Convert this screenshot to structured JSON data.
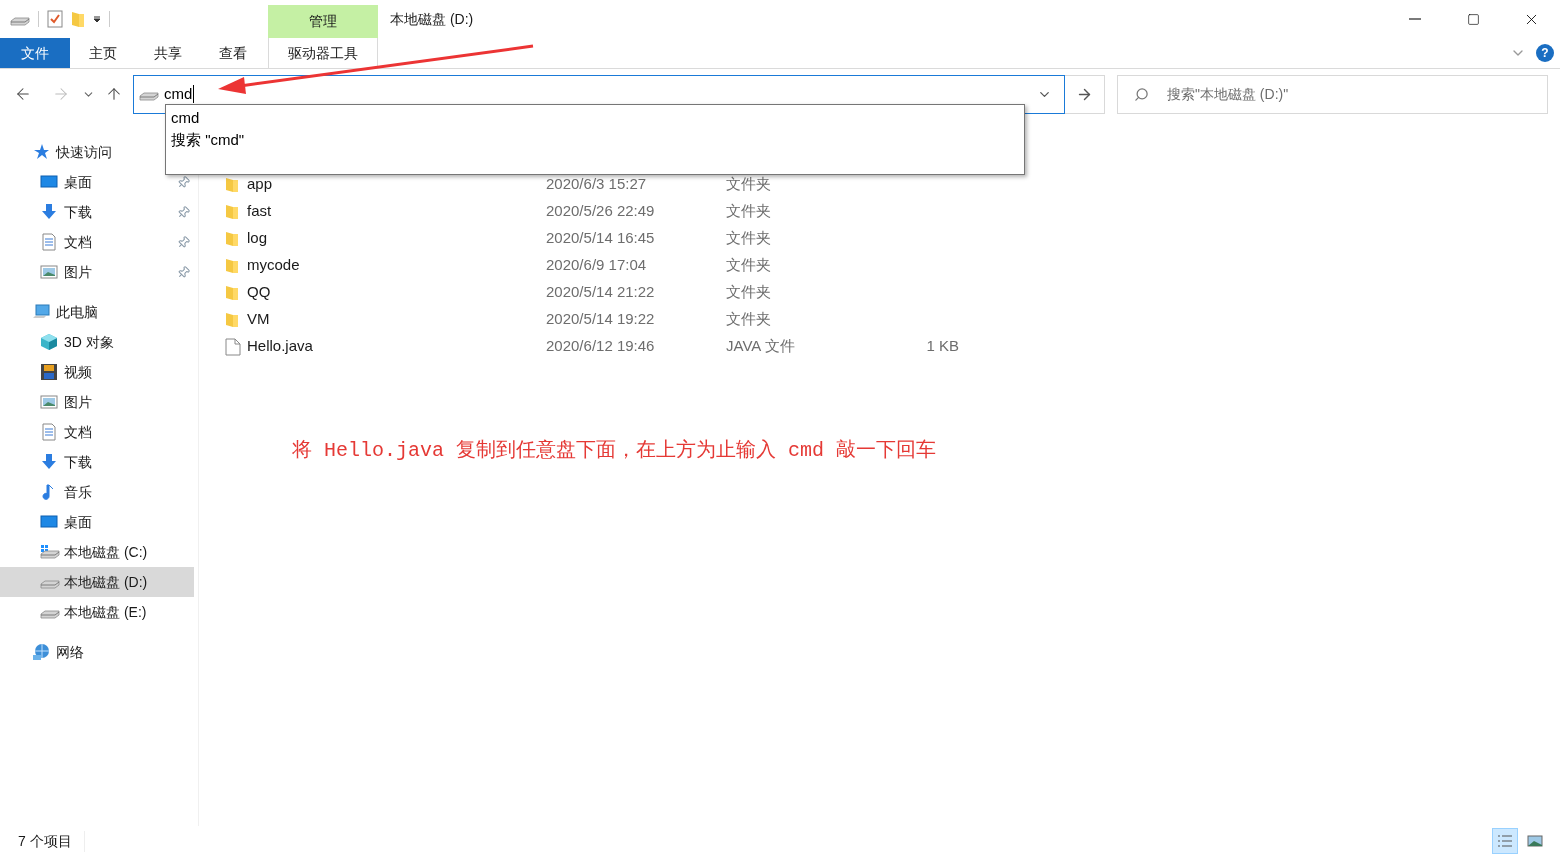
{
  "window": {
    "title": "本地磁盘 (D:)",
    "context_tab": "管理"
  },
  "help": {
    "label": "?"
  },
  "ribbon": {
    "tabs": [
      {
        "label": "文件",
        "kind": "file",
        "selected": false
      },
      {
        "label": "主页",
        "kind": "tab",
        "selected": false
      },
      {
        "label": "共享",
        "kind": "tab",
        "selected": false
      },
      {
        "label": "查看",
        "kind": "tab",
        "selected": false
      },
      {
        "label": "驱动器工具",
        "kind": "context",
        "selected": false
      }
    ]
  },
  "address": {
    "value": "cmd",
    "suggestions": [
      "cmd",
      "搜索 \"cmd\""
    ]
  },
  "search": {
    "placeholder": "搜索\"本地磁盘 (D:)\""
  },
  "sidebar": {
    "items": [
      {
        "label": "快速访问",
        "kind": "star",
        "selected": false,
        "children": [
          {
            "label": "桌面",
            "kind": "desktop",
            "pinned": true,
            "selected": false
          },
          {
            "label": "下载",
            "kind": "download",
            "pinned": true,
            "selected": false
          },
          {
            "label": "文档",
            "kind": "document",
            "pinned": true,
            "selected": false
          },
          {
            "label": "图片",
            "kind": "picture",
            "pinned": true,
            "selected": false
          }
        ]
      },
      {
        "label": "此电脑",
        "kind": "pc",
        "selected": false,
        "children": [
          {
            "label": "3D 对象",
            "kind": "cube",
            "pinned": false,
            "selected": false
          },
          {
            "label": "视频",
            "kind": "video",
            "pinned": false,
            "selected": false
          },
          {
            "label": "图片",
            "kind": "picture",
            "pinned": false,
            "selected": false
          },
          {
            "label": "文档",
            "kind": "document",
            "pinned": false,
            "selected": false
          },
          {
            "label": "下载",
            "kind": "download",
            "pinned": false,
            "selected": false
          },
          {
            "label": "音乐",
            "kind": "music",
            "pinned": false,
            "selected": false
          },
          {
            "label": "桌面",
            "kind": "desktop",
            "pinned": false,
            "selected": false
          },
          {
            "label": "本地磁盘 (C:)",
            "kind": "drive",
            "pinned": false,
            "selected": false
          },
          {
            "label": "本地磁盘 (D:)",
            "kind": "drive",
            "pinned": false,
            "selected": true
          },
          {
            "label": "本地磁盘 (E:)",
            "kind": "drive",
            "pinned": false,
            "selected": false
          }
        ]
      },
      {
        "label": "网络",
        "kind": "network",
        "selected": false
      }
    ]
  },
  "files": [
    {
      "name": "app",
      "date": "2020/6/3 15:27",
      "type": "文件夹",
      "kind": "folder"
    },
    {
      "name": "fast",
      "date": "2020/5/26 22:49",
      "type": "文件夹",
      "kind": "folder"
    },
    {
      "name": "log",
      "date": "2020/5/14 16:45",
      "type": "文件夹",
      "kind": "folder"
    },
    {
      "name": "mycode",
      "date": "2020/6/9 17:04",
      "type": "文件夹",
      "kind": "folder"
    },
    {
      "name": "QQ",
      "date": "2020/5/14 21:22",
      "type": "文件夹",
      "kind": "folder"
    },
    {
      "name": "VM",
      "date": "2020/5/14 19:22",
      "type": "文件夹",
      "kind": "folder"
    },
    {
      "name": "Hello.java",
      "date": "2020/6/12 19:46",
      "type": "JAVA 文件",
      "size": "1 KB",
      "kind": "file"
    }
  ],
  "annotation": "将 Hello.java 复制到任意盘下面，在上方为止输入 cmd 敲一下回车",
  "status_bar": {
    "count": "7 个项目"
  },
  "views": [
    {
      "kind": "details",
      "selected": true
    },
    {
      "kind": "thumbnails",
      "selected": false
    }
  ]
}
